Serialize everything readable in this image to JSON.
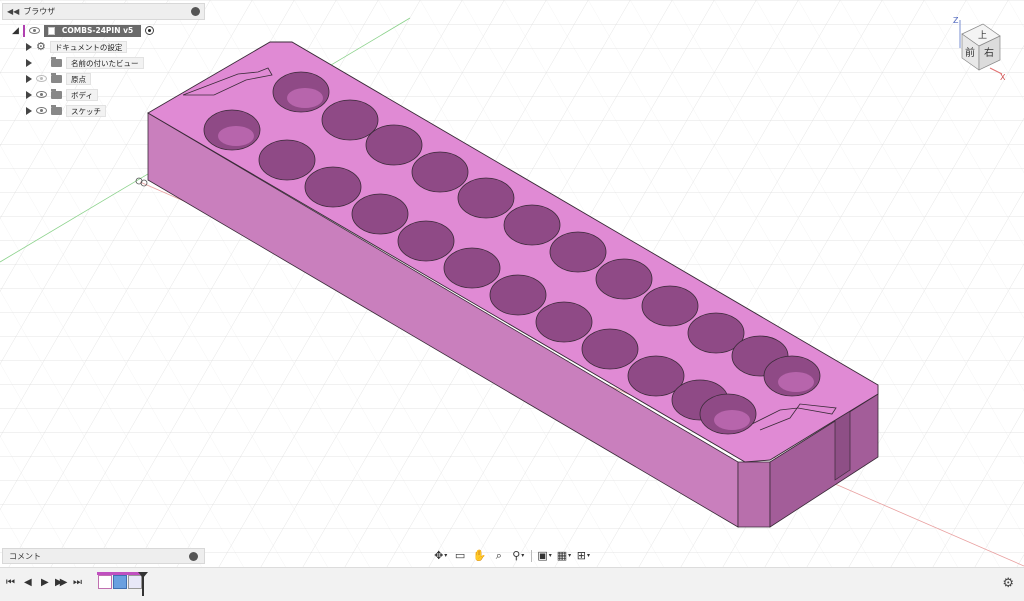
{
  "browser": {
    "title": "ブラウザ",
    "root": {
      "label": "COMBS-24PIN v5"
    },
    "items": [
      {
        "label": "ドキュメントの設定",
        "icon": "gear-icon"
      },
      {
        "label": "名前の付いたビュー",
        "icon": "folder-icon"
      },
      {
        "label": "原点",
        "icon": "folder-icon",
        "visibility": "hidden"
      },
      {
        "label": "ボディ",
        "icon": "folder-icon",
        "visibility": "visible"
      },
      {
        "label": "スケッチ",
        "icon": "folder-icon",
        "visibility": "visible"
      }
    ]
  },
  "viewcube": {
    "top": "上",
    "front": "前",
    "right": "右",
    "axis_z": "Z",
    "axis_x": "X"
  },
  "comments": {
    "title": "コメント"
  },
  "nav_toolbar": {
    "buttons": [
      {
        "name": "orbit-tool",
        "icon": "✥"
      },
      {
        "name": "look-at-tool",
        "icon": "▭"
      },
      {
        "name": "pan-tool",
        "icon": "✋"
      },
      {
        "name": "zoom-window-tool",
        "icon": "⌕"
      },
      {
        "name": "zoom-tool",
        "icon": "⚲"
      },
      {
        "name": "display-settings",
        "icon": "▣"
      },
      {
        "name": "grid-settings",
        "icon": "▦"
      },
      {
        "name": "viewports",
        "icon": "⊞"
      }
    ]
  },
  "timeline": {
    "controls": [
      "⏮",
      "◀",
      "▶",
      "▶▶",
      "⏭"
    ]
  },
  "colors": {
    "body_top": "#e07fd4",
    "body_side": "#c976bd",
    "body_dark": "#9e4f95",
    "grid": "#d9d9d9"
  }
}
